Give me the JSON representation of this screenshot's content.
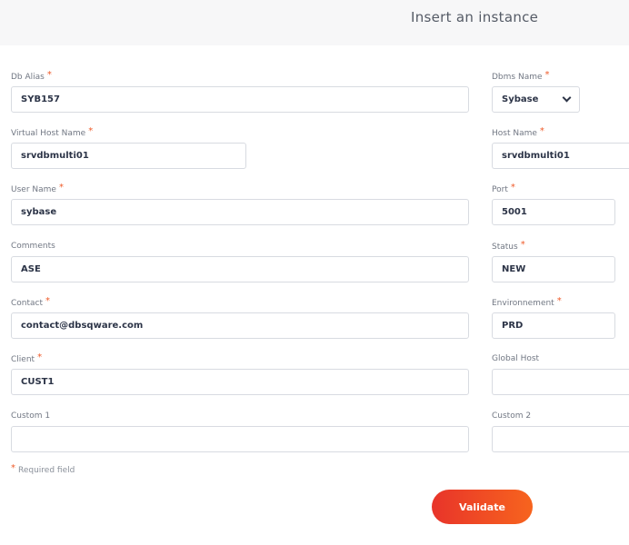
{
  "header": {
    "title": "Insert an instance"
  },
  "required_marker": "*",
  "fields": {
    "db_alias": {
      "label": "Db Alias",
      "value": "SYB157"
    },
    "dbms_name": {
      "label": "Dbms Name",
      "value": "Sybase"
    },
    "virtual_host_name": {
      "label": "Virtual Host Name",
      "value": "srvdbmulti01"
    },
    "host_name": {
      "label": "Host Name",
      "value": "srvdbmulti01"
    },
    "user_name": {
      "label": "User Name",
      "value": "sybase"
    },
    "port": {
      "label": "Port",
      "value": "5001"
    },
    "comments": {
      "label": "Comments",
      "value": "ASE"
    },
    "status": {
      "label": "Status",
      "value": "NEW"
    },
    "contact": {
      "label": "Contact",
      "value": "contact@dbsqware.com"
    },
    "environnement": {
      "label": "Environnement",
      "value": "PRD"
    },
    "client": {
      "label": "Client",
      "value": "CUST1"
    },
    "global_host": {
      "label": "Global Host",
      "value": ""
    },
    "custom1": {
      "label": "Custom 1",
      "value": ""
    },
    "custom2": {
      "label": "Custom 2",
      "value": ""
    }
  },
  "footer": {
    "required_note": "Required field",
    "validate_label": "Validate"
  },
  "colors": {
    "accent": "#ef5b2a",
    "button_start": "#e8342a",
    "button_end": "#f7641e"
  }
}
